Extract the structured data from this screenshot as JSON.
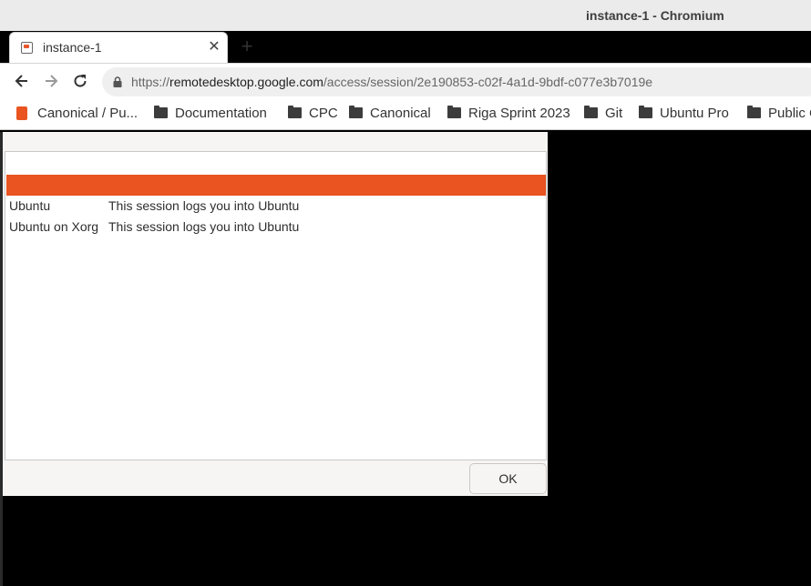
{
  "window": {
    "title": "instance-1 - Chromium"
  },
  "tab": {
    "title": "instance-1",
    "close_glyph": "✕",
    "new_tab_glyph": "+"
  },
  "toolbar": {
    "url_scheme": "https://",
    "url_domain": "remotedesktop.google.com",
    "url_path": "/access/session/2e190853-c02f-4a1d-9bdf-c077e3b7019e"
  },
  "bookmarks": [
    {
      "label": "Canonical / Pu...",
      "icon": "ubuntu-favicon"
    },
    {
      "label": "Documentation",
      "icon": "folder-icon"
    },
    {
      "label": "CPC",
      "icon": "folder-icon"
    },
    {
      "label": "Canonical",
      "icon": "folder-icon"
    },
    {
      "label": "Riga Sprint 2023",
      "icon": "folder-icon"
    },
    {
      "label": "Git",
      "icon": "folder-icon"
    },
    {
      "label": "Ubuntu Pro",
      "icon": "folder-icon"
    },
    {
      "label": "Public C",
      "icon": "folder-icon"
    }
  ],
  "session_dialog": {
    "rows": [
      {
        "name": "Ubuntu",
        "description": "This session logs you into Ubuntu"
      },
      {
        "name": "Ubuntu on Xorg",
        "description": "This session logs you into Ubuntu"
      }
    ],
    "ok_label": "OK",
    "selected_color": "#e95420"
  }
}
